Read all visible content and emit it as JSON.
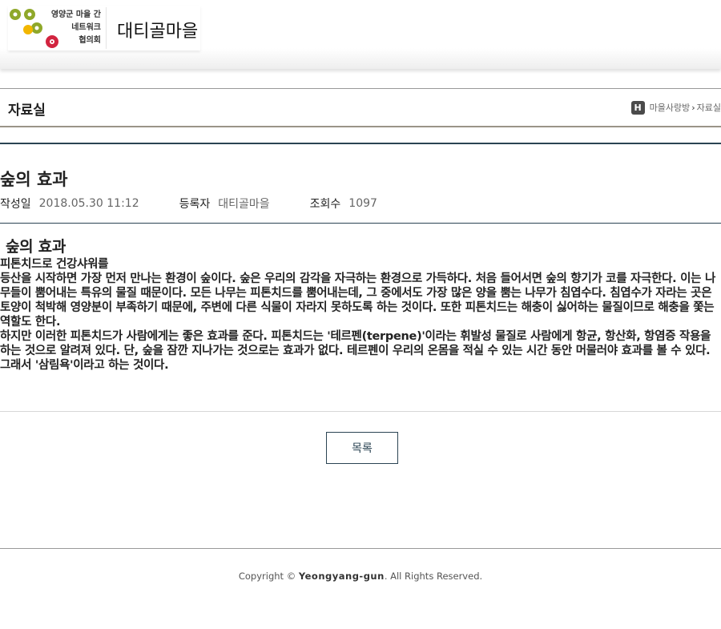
{
  "header": {
    "org_lines": [
      "영양군 마을 간",
      "네트워크",
      "협의회"
    ],
    "village_name": "대티골마을"
  },
  "subnav": {
    "title": "자료실",
    "home_icon_text": "H",
    "breadcrumb": [
      "마을사랑방",
      "자료실"
    ]
  },
  "post": {
    "title": "숲의 효과",
    "meta": {
      "date_label": "작성일",
      "date_value": "2018.05.30 11:12",
      "author_label": "등록자",
      "author_value": "대티골마을",
      "views_label": "조회수",
      "views_value": "1097"
    },
    "body_heading": "숲의 효과",
    "paragraphs": [
      "피톤치드로 건강샤워를",
      "등산을 시작하면 가장 먼저 만나는 환경이 숲이다. 숲은 우리의 감각을 자극하는 환경으로 가득하다. 처음 들어서면 숲의 향기가 코를 자극한다. 이는 나무들이 뿜어내는 특유의 물질 때문이다. 모든 나무는 피톤치드를 뿜어내는데, 그 중에서도 가장 많은 양을 뿜는 나무가 침엽수다. 침엽수가 자라는 곳은 토양이 척박해 영양분이 부족하기 때문에, 주변에 다른 식물이 자라지 못하도록 하는 것이다. 또한 피톤치드는 해충이 싫어하는 물질이므로 해충을 쫓는 역할도 한다.",
      "하지만 이러한 피톤치드가 사람에게는 좋은 효과를 준다. 피톤치드는 '테르펜(terpene)'이라는 휘발성 물질로 사람에게 항균, 항산화, 항염증 작용을 하는 것으로 알려져 있다. 단, 숲을 잠깐 지나가는 것으로는 효과가 없다. 테르펜이 우리의 온몸을 적실 수 있는 시간 동안 머물러야 효과를 볼 수 있다. 그래서 '삼림욕'이라고 하는 것이다."
    ],
    "list_button": "목록"
  },
  "footer": {
    "prefix": "Copyright ©",
    "brand": "Yeongyang-gun",
    "suffix": ". All Rights Reserved."
  },
  "colors": {
    "accent_navy": "#2b4453",
    "logo_olive": "#8fa82a",
    "logo_yellow": "#f2b600",
    "logo_red": "#d2243f"
  }
}
